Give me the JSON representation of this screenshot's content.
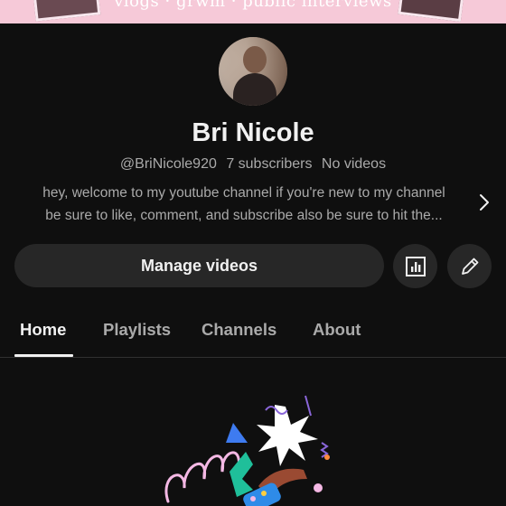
{
  "banner": {
    "text": "vlogs · grwm · public interviews"
  },
  "channel": {
    "name": "Bri Nicole",
    "handle": "@BriNicole920",
    "subscribers": "7 subscribers",
    "videos": "No videos",
    "description_line1": "hey, welcome to my youtube channel if you're new to my channel",
    "description_line2": "be sure to like, comment, and subscribe also be sure to hit the..."
  },
  "actions": {
    "manage_label": "Manage videos",
    "stats_icon": "bar-chart-icon",
    "edit_icon": "pencil-icon"
  },
  "tabs": [
    {
      "label": "Home",
      "active": true
    },
    {
      "label": "Playlists",
      "active": false
    },
    {
      "label": "Channels",
      "active": false
    },
    {
      "label": "About",
      "active": false
    }
  ],
  "colors": {
    "background": "#0f0f0f",
    "button": "#272727",
    "text": "#f1f1f1",
    "secondary_text": "#aaaaaa",
    "banner": "#f6c9d8"
  }
}
